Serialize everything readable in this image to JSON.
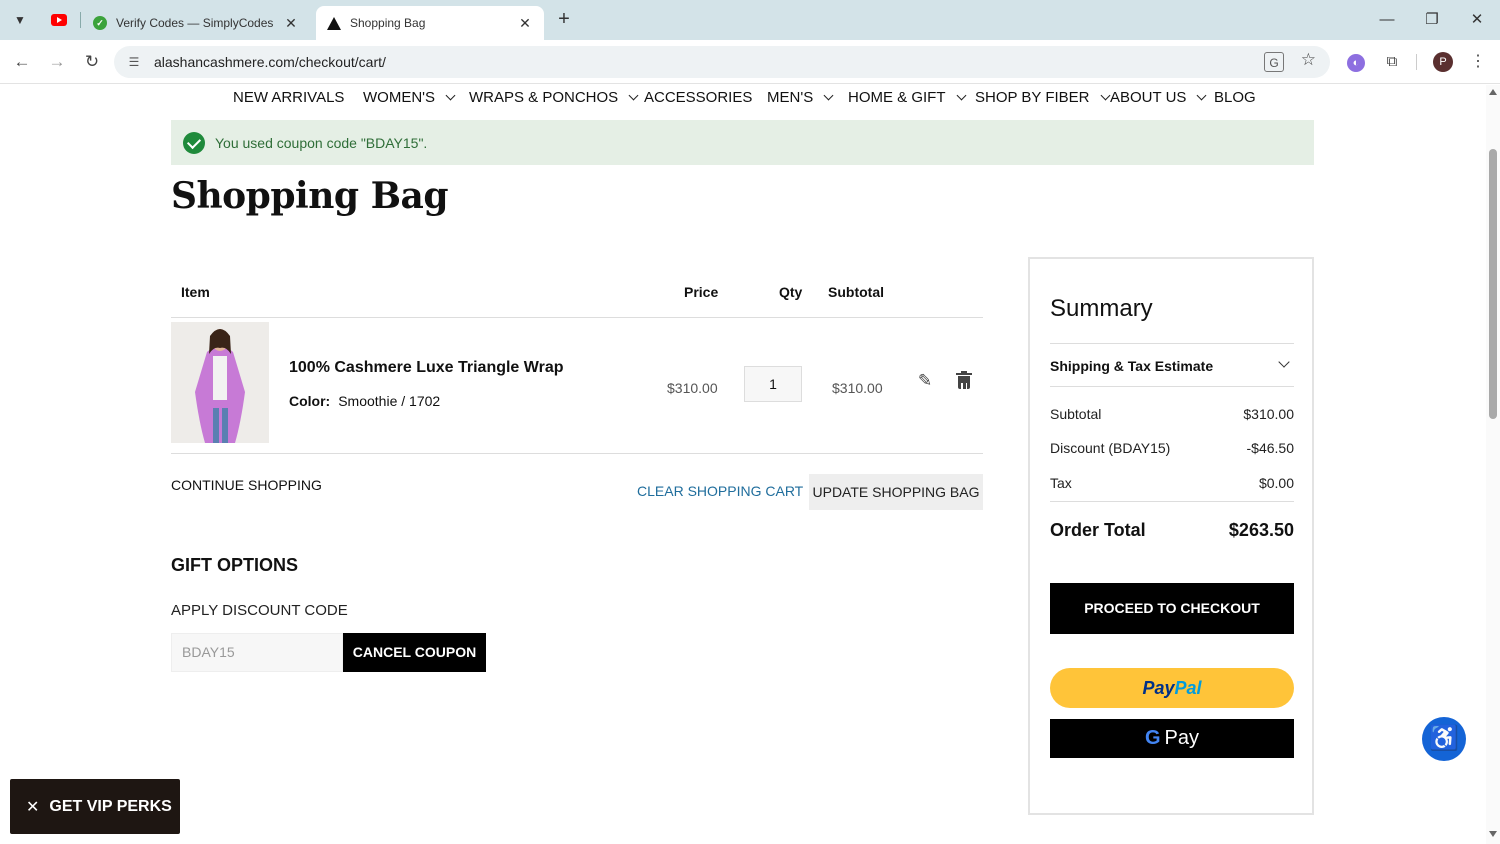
{
  "browser": {
    "tabs": [
      {
        "title": "Verify Codes — SimplyCodes",
        "close": "✕"
      },
      {
        "title": "Shopping Bag",
        "close": "✕"
      }
    ],
    "new_tab": "+",
    "url": "alashancashmere.com/checkout/cart/",
    "window_controls": {
      "minimize": "—",
      "maximize": "❐",
      "close": "✕"
    },
    "profile_initial": "P",
    "icons": [
      "tab-search-icon",
      "youtube-icon",
      "back-icon",
      "forward-icon",
      "reload-icon",
      "site-info-icon",
      "translate-icon",
      "bookmark-star-icon",
      "extension-icon",
      "puzzle-icon",
      "menu-icon"
    ]
  },
  "nav": {
    "items": [
      {
        "label": "NEW ARRIVALS"
      },
      {
        "label": "WOMEN'S"
      },
      {
        "label": "WRAPS & PONCHOS"
      },
      {
        "label": "ACCESSORIES"
      },
      {
        "label": "MEN'S"
      },
      {
        "label": "HOME & GIFT"
      },
      {
        "label": "SHOP BY FIBER"
      },
      {
        "label": "ABOUT US"
      },
      {
        "label": "BLOG"
      }
    ]
  },
  "message": "You used coupon code \"BDAY15\".",
  "page_title": "Shopping Bag",
  "cart": {
    "headers": {
      "item": "Item",
      "price": "Price",
      "qty": "Qty",
      "subtotal": "Subtotal"
    },
    "items": [
      {
        "name": "100% Cashmere Luxe Triangle Wrap",
        "option_label": "Color:",
        "option_value": "Smoothie / 1702",
        "price": "$310.00",
        "qty": "1",
        "subtotal": "$310.00"
      }
    ],
    "continue": "CONTINUE SHOPPING",
    "clear": "CLEAR SHOPPING CART",
    "update": "UPDATE SHOPPING BAG"
  },
  "gift_options": "GIFT OPTIONS",
  "discount": {
    "label": "APPLY DISCOUNT CODE",
    "value": "BDAY15",
    "button": "CANCEL COUPON"
  },
  "summary": {
    "title": "Summary",
    "shipping_label": "Shipping & Tax Estimate",
    "rows": [
      {
        "label": "Subtotal",
        "value": "$310.00"
      },
      {
        "label": "Discount (BDAY15)",
        "value": "-$46.50"
      },
      {
        "label": "Tax",
        "value": "$0.00"
      }
    ],
    "total_label": "Order Total",
    "total_value": "$263.50",
    "checkout": "PROCEED TO CHECKOUT",
    "paypal": {
      "part1": "Pay",
      "part2": "Pal"
    },
    "gpay": {
      "g": "G",
      "text": "Pay"
    }
  },
  "vip": {
    "close": "✕",
    "label": "GET VIP PERKS"
  },
  "accessibility_icon": "♿",
  "colors": {
    "message_bg": "#e5efe5",
    "message_text": "#2f6e38",
    "link_blue": "#1f6d9c",
    "paypal_yellow": "#ffc439",
    "accessibility_blue": "#1464d6"
  }
}
